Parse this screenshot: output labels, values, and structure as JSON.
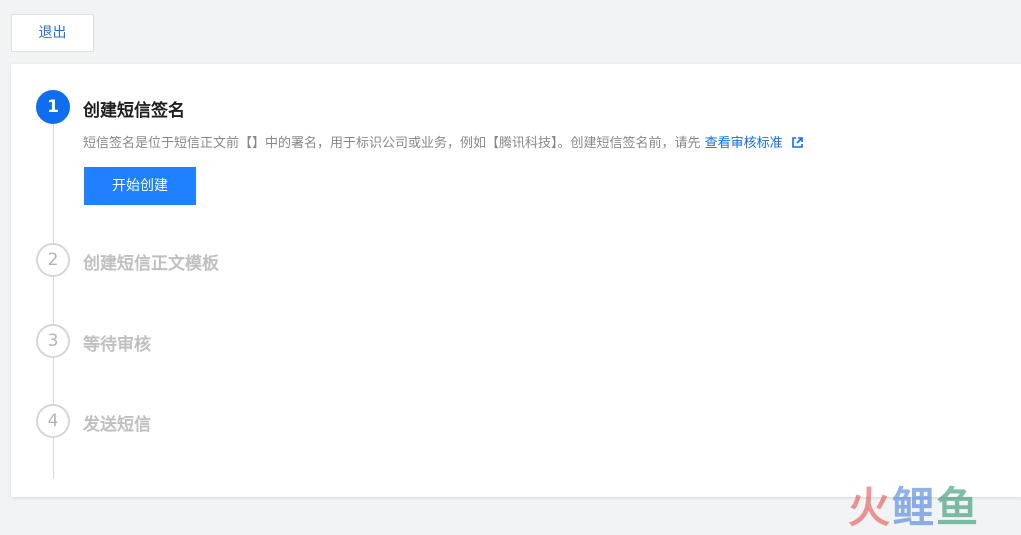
{
  "toolbar": {
    "exit_label": "退出"
  },
  "steps": [
    {
      "number": "1",
      "title": "创建短信签名",
      "active": true,
      "description": "短信签名是位于短信正文前【】中的署名，用于标识公司或业务，例如【腾讯科技】。创建短信签名前，请先",
      "link_label": "查看审核标准",
      "button_label": "开始创建"
    },
    {
      "number": "2",
      "title": "创建短信正文模板",
      "active": false
    },
    {
      "number": "3",
      "title": "等待审核",
      "active": false
    },
    {
      "number": "4",
      "title": "发送短信",
      "active": false
    }
  ],
  "icons": {
    "external_link": "external-link-icon"
  },
  "colors": {
    "primary": "#0f6ef0",
    "button": "#1f81ff",
    "inactive": "#c0c0c0"
  },
  "watermark": {
    "char1": "火",
    "char2": "鲤",
    "char3": "鱼"
  }
}
